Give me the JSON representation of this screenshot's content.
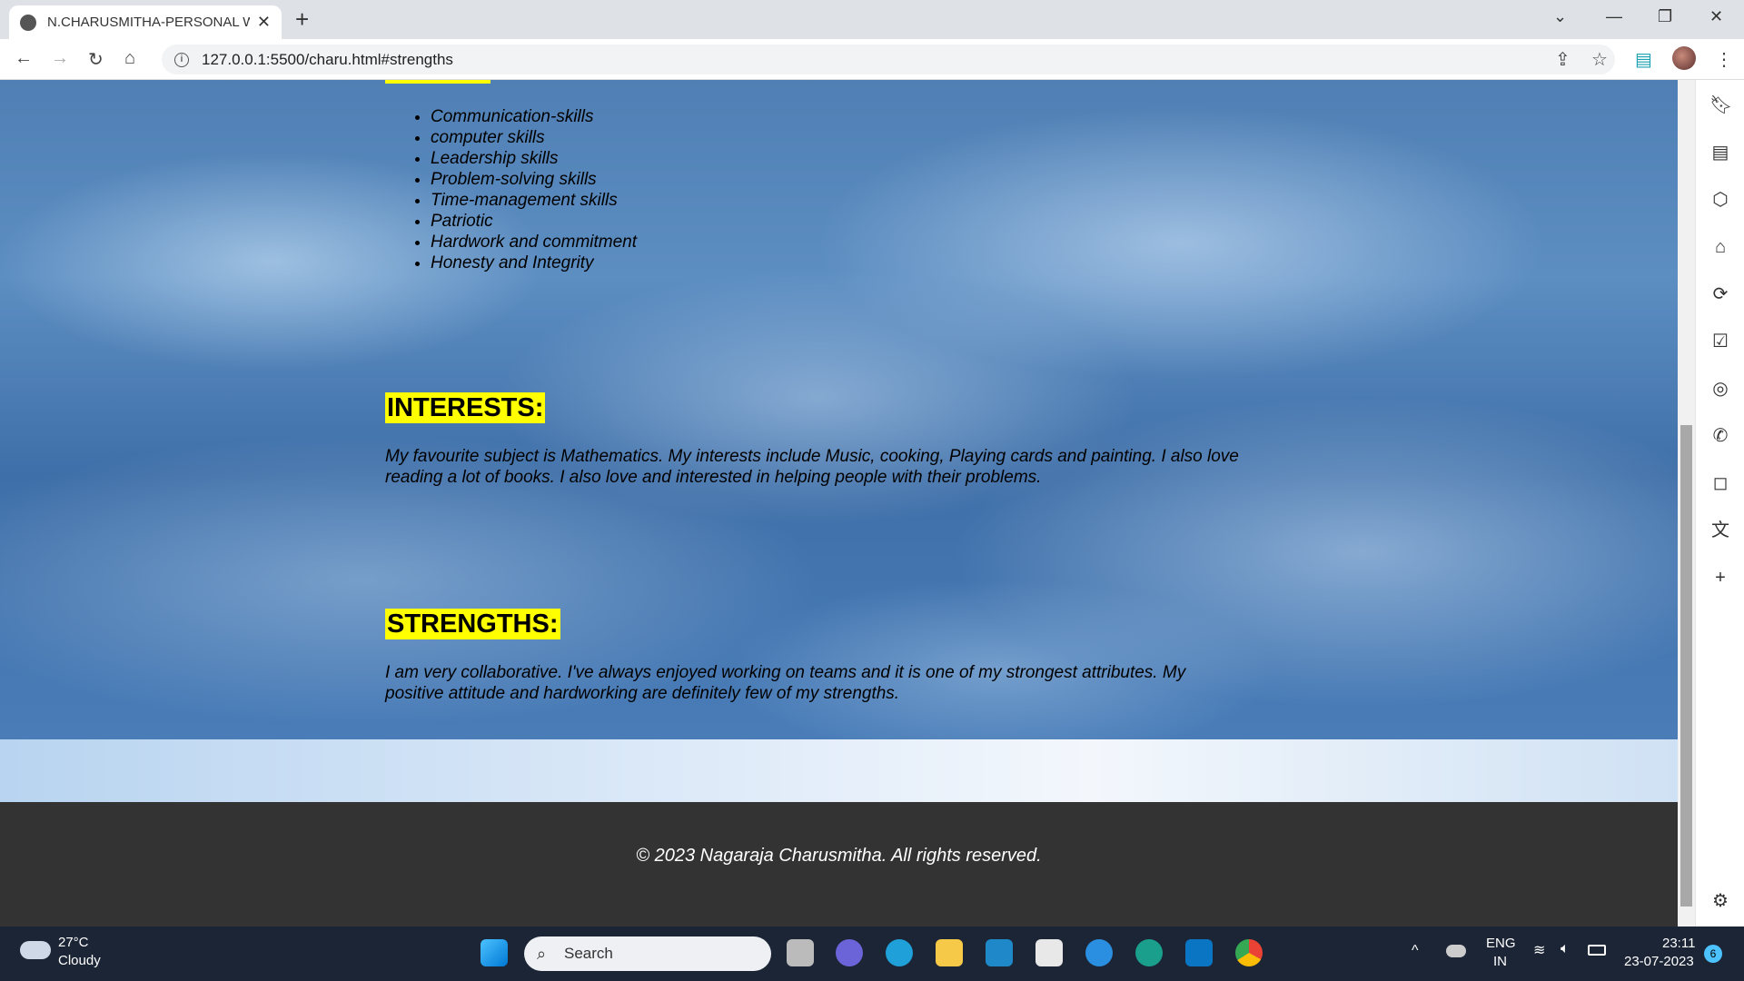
{
  "browser": {
    "tab_title": "N.CHARUSMITHA-PERSONAL WE",
    "url": "127.0.0.1:5500/charu.html#strengths"
  },
  "page": {
    "skills": [
      "Communication-skills",
      "computer skills",
      "Leadership skills",
      "Problem-solving skills",
      "Time-management skills",
      "Patriotic",
      "Hardwork and commitment",
      "Honesty and Integrity"
    ],
    "interests": {
      "heading": "INTERESTS:",
      "text": "My favourite subject is Mathematics. My interests include Music, cooking, Playing cards and painting. I also love reading a lot of books. I also love and interested in helping people with their problems."
    },
    "strengths": {
      "heading": "STRENGTHS:",
      "text": "I am very collaborative. I've always enjoyed working on teams and it is one of my strongest attributes. My positive attitude and hardworking are definitely few of my strengths."
    },
    "footer": "© 2023 Nagaraja Charusmitha. All rights reserved."
  },
  "taskbar": {
    "temp": "27°C",
    "weather": "Cloudy",
    "search": "Search",
    "lang1": "ENG",
    "lang2": "IN",
    "time": "23:11",
    "date": "23-07-2023",
    "badge": "6"
  }
}
